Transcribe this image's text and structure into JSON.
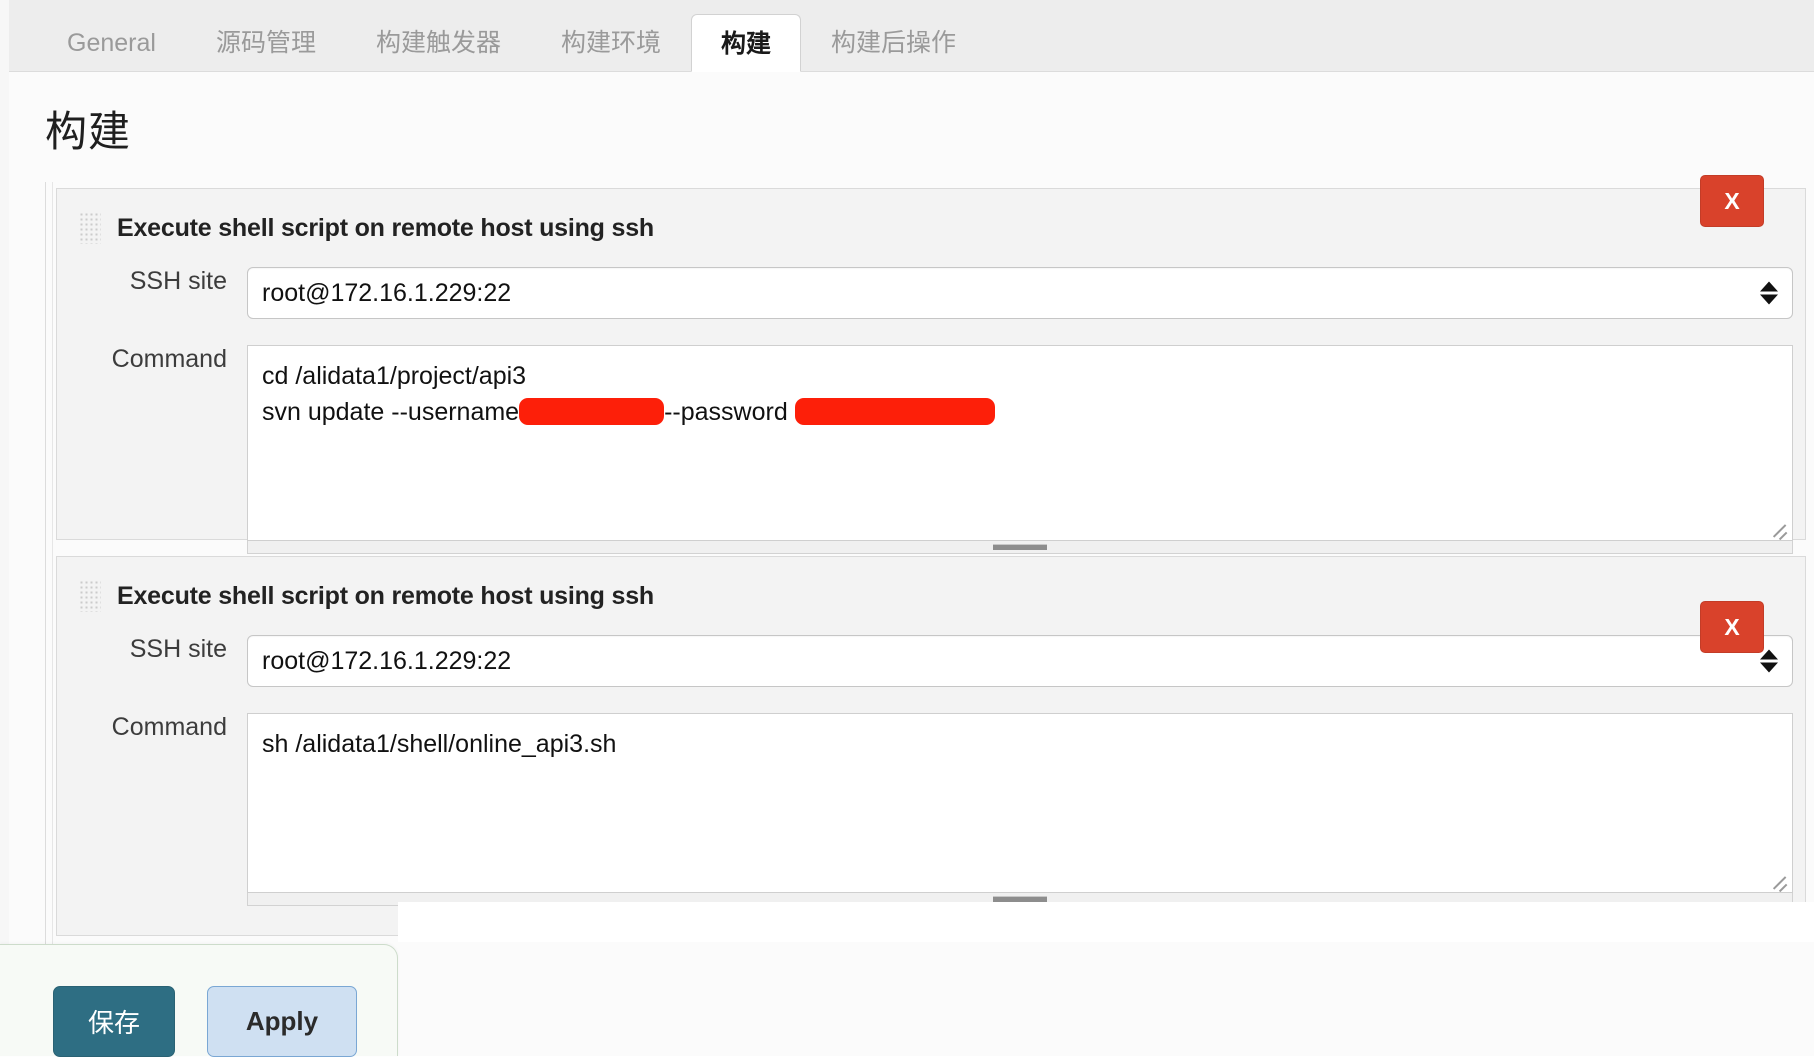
{
  "window": {
    "title": "构建"
  },
  "tabs": [
    {
      "label": "General",
      "active": false
    },
    {
      "label": "源码管理",
      "active": false
    },
    {
      "label": "构建触发器",
      "active": false
    },
    {
      "label": "构建环境",
      "active": false
    },
    {
      "label": "构建",
      "active": true
    },
    {
      "label": "构建后操作",
      "active": false
    }
  ],
  "page": {
    "title": "构建"
  },
  "build_steps": [
    {
      "title": "Execute shell script on remote host using ssh",
      "remove_label": "X",
      "grip_icon": "drag-grip-icon",
      "fields": {
        "ssh_site_label": "SSH site",
        "ssh_site_value": "root@172.16.1.229:22",
        "command_label": "Command",
        "command_line1": "cd /alidata1/project/api3",
        "command_line2_prefix": "svn update --username",
        "command_line2_mid": "--password ",
        "command_redacted": true
      }
    },
    {
      "title": "Execute shell script on remote host using ssh",
      "remove_label": "X",
      "grip_icon": "drag-grip-icon",
      "fields": {
        "ssh_site_label": "SSH site",
        "ssh_site_value": "root@172.16.1.229:22",
        "command_label": "Command",
        "command_line1": "sh /alidata1/shell/online_api3.sh"
      }
    }
  ],
  "footer": {
    "save_label": "保存",
    "apply_label": "Apply"
  },
  "colors": {
    "tabbar_bg": "#ededed",
    "active_tab_bg": "#ffffff",
    "content_bg": "#fbfbfb",
    "block_bg": "#f3f3f3",
    "remove_button": "#d9422b",
    "save_button": "#2e6e83",
    "apply_button": "#cfe0f2",
    "redaction": "#fd1f09",
    "panel_bg": "#f7faf6"
  }
}
